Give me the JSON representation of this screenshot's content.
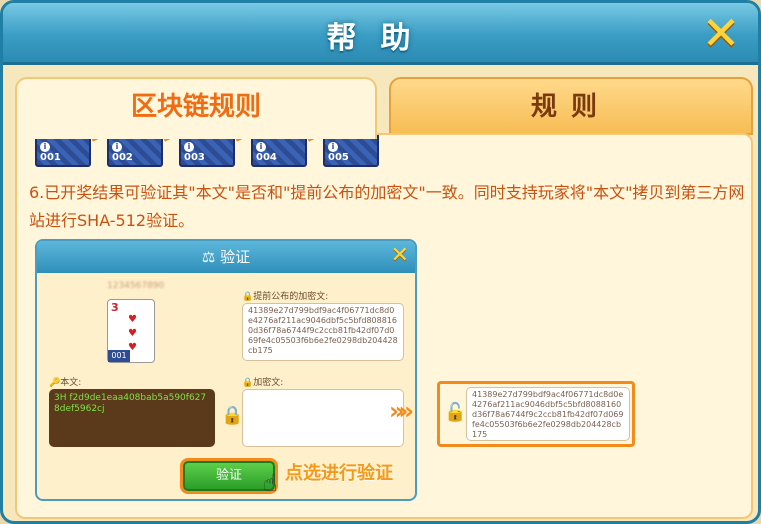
{
  "header": {
    "title": "帮助"
  },
  "tabs": [
    {
      "label": "区块链规则",
      "active": true
    },
    {
      "label": "规则",
      "active": false
    }
  ],
  "blocks": [
    "001",
    "002",
    "003",
    "004",
    "005"
  ],
  "rule": {
    "text": "6.已开奖结果可验证其\"本文\"是否和\"提前公布的加密文\"一致。同时支持玩家将\"本文\"拷贝到第三方网站进行SHA-512验证。"
  },
  "verify_panel": {
    "title": "验证",
    "blurred_id": "1234567890",
    "card_rank": "3",
    "card_number": "001",
    "announced_label": "提前公布的加密文:",
    "announced_hash": "41389e27d799bdf9ac4f06771dc8d0e4276af211ac9046dbf5c5bfd8088160d36f78a6744f9c2ccb81fb42df07d069fe4c05503f6b6e2fe0298db204428cb175",
    "plaintext_label": "本文:",
    "plaintext": "3H f2d9de1eaa408bab5a590f6278def5962cj",
    "cipher_label": "加密文:",
    "verify_button": "验证"
  },
  "click_hint": "点选进行验证",
  "result_hash": "41389e27d799bdf9ac4f06771dc8d0e4276af211ac9046dbf5c5bfd8088160d36f78a6744f9c2ccb81fb42df07d069fe4c05503f6b6e2fe0298db204428cb175",
  "colors": {
    "accent": "#f28a1c",
    "header_blue": "#3a9dc4",
    "text_orange": "#c9520f"
  },
  "icons": {
    "close": "close-icon",
    "lock": "lock-icon",
    "unlock": "unlock-icon",
    "key": "key-icon",
    "scale": "scale-icon",
    "hand": "hand-pointer-icon"
  }
}
